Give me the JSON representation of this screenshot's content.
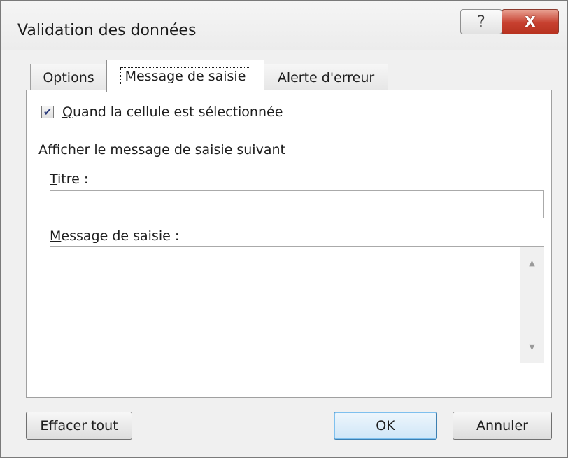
{
  "window": {
    "title": "Validation des données",
    "help_label": "?",
    "close_label": "X"
  },
  "tabs": [
    {
      "label": "Options",
      "selected": false
    },
    {
      "label": "Message de saisie",
      "selected": true
    },
    {
      "label": "Alerte d'erreur",
      "selected": false
    }
  ],
  "panel": {
    "checkbox": {
      "label": "Quand la cellule est sélectionnée",
      "label_underline_char": "Q",
      "label_rest": "uand la cellule est sélectionnée",
      "checked": true,
      "check_glyph": "✔"
    },
    "group_label": "Afficher le message de saisie suivant",
    "titre_label_u": "T",
    "titre_label_rest": "itre :",
    "titre_value": "",
    "message_label_u": "M",
    "message_label_rest": "essage de saisie :",
    "message_value": "",
    "scroll_up_glyph": "▲",
    "scroll_down_glyph": "▼"
  },
  "buttons": {
    "clear_u": "E",
    "clear_rest": "ffacer tout",
    "ok": "OK",
    "cancel": "Annuler"
  }
}
